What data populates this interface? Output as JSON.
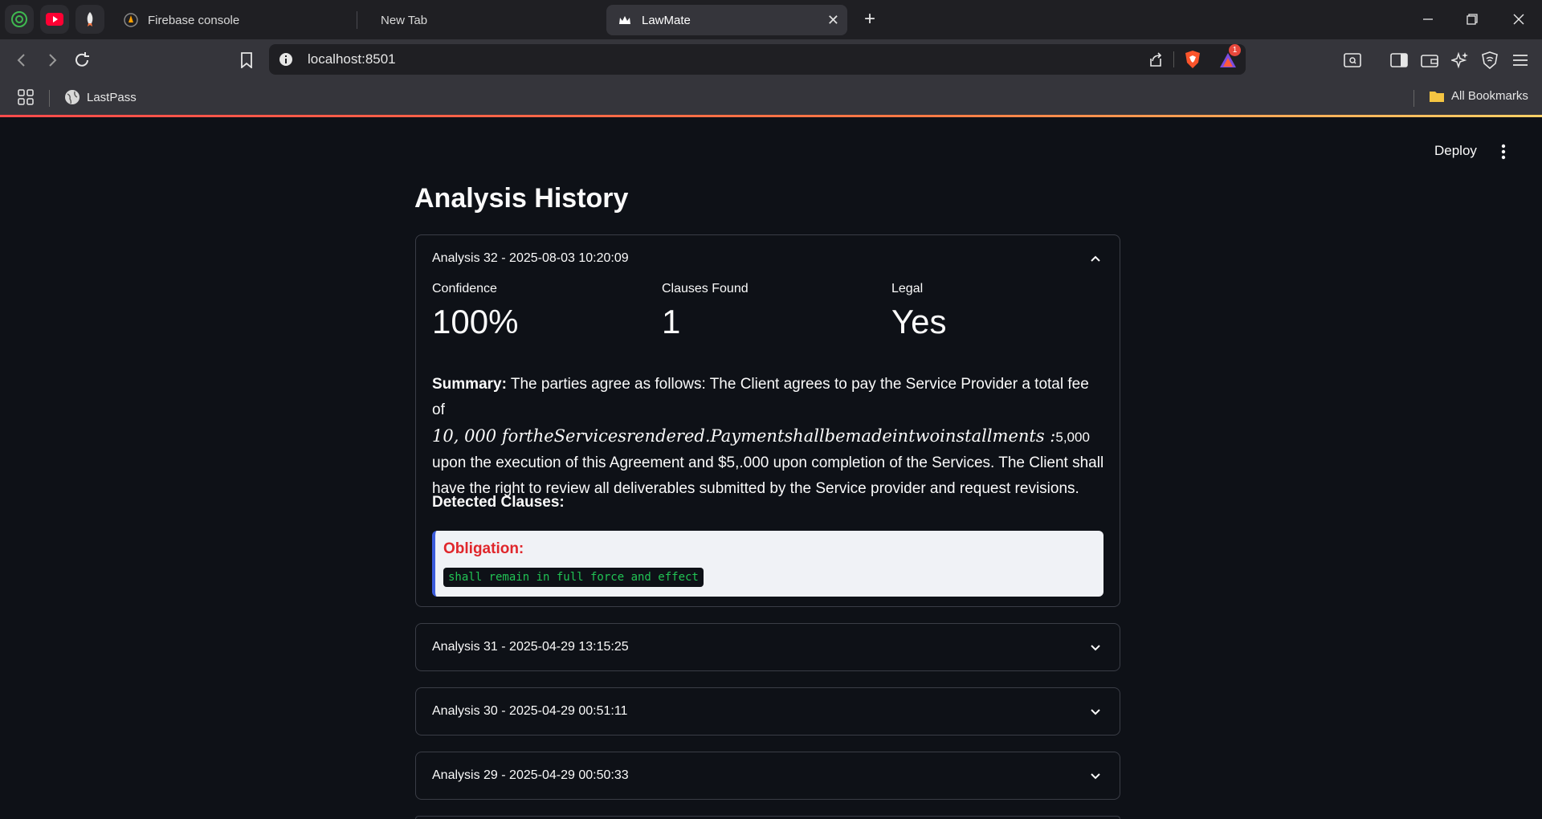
{
  "browser": {
    "tabs": [
      {
        "title": "Firebase console"
      },
      {
        "title": "New Tab"
      },
      {
        "title": "LawMate"
      }
    ],
    "url": "localhost:8501",
    "bookmarks": [
      {
        "label": "LastPass"
      },
      {
        "label": "All Bookmarks"
      }
    ],
    "notification_count": "1"
  },
  "app": {
    "deploy_label": "Deploy",
    "page_title": "Analysis History",
    "analyses": [
      {
        "header": "Analysis 32 - 2025-08-03 10:20:09",
        "expanded": true,
        "metrics": [
          {
            "label": "Confidence",
            "value": "100%"
          },
          {
            "label": "Clauses Found",
            "value": "1"
          },
          {
            "label": "Legal",
            "value": "Yes"
          }
        ],
        "summary_label": "Summary:",
        "summary_part1": "The parties agree as follows: The Client agrees to pay the Service Provider a total fee of",
        "summary_math": "10, 000 fortheServicesrendered.Paymentshallbemadeintwoinstallments :",
        "summary_part2": "5,000",
        "summary_part3": "upon the execution of this Agreement and $5,.000 upon completion of the Services. The Client shall have the right to review all deliverables submitted by the Service provider and request revisions.",
        "detected_label": "Detected Clauses:",
        "clauses": [
          {
            "type": "Obligation:",
            "text": "shall remain in full force and effect"
          }
        ]
      },
      {
        "header": "Analysis 31 - 2025-04-29 13:15:25",
        "expanded": false
      },
      {
        "header": "Analysis 30 - 2025-04-29 00:51:11",
        "expanded": false
      },
      {
        "header": "Analysis 29 - 2025-04-29 00:50:33",
        "expanded": false
      }
    ]
  }
}
